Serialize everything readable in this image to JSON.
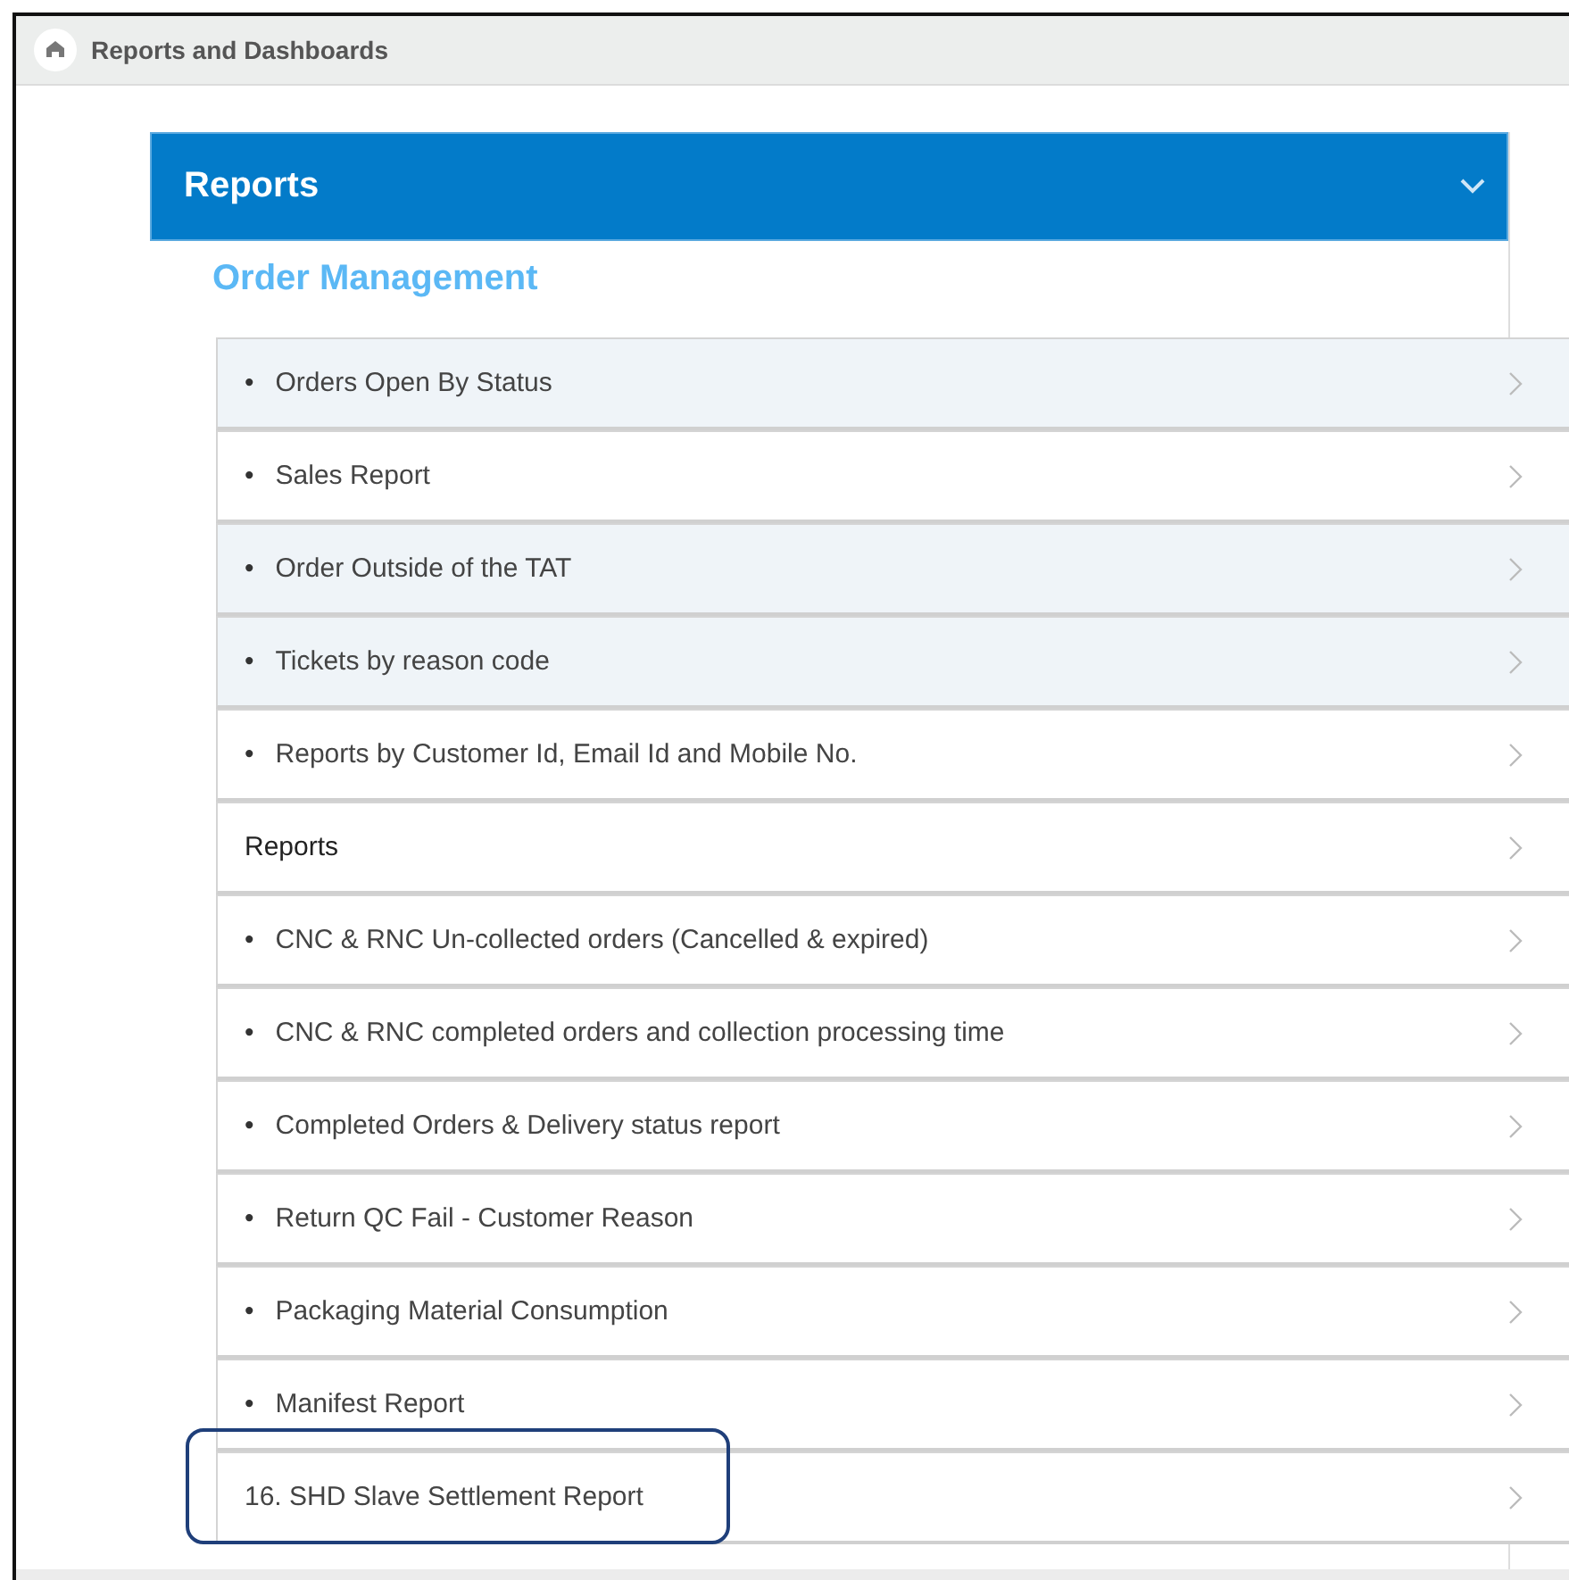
{
  "breadcrumb": {
    "title": "Reports and Dashboards"
  },
  "panel": {
    "title": "Reports",
    "expanded": true,
    "section_title": "Order Management",
    "items": [
      {
        "kind": "bullet",
        "bullet": "•",
        "label": "Orders Open By Status",
        "shaded": true,
        "annotated": false
      },
      {
        "kind": "bullet",
        "bullet": "•",
        "label": "Sales Report",
        "shaded": false,
        "annotated": false
      },
      {
        "kind": "bullet",
        "bullet": "•",
        "label": "Order Outside of the TAT",
        "shaded": true,
        "annotated": false
      },
      {
        "kind": "bullet",
        "bullet": "•",
        "label": "Tickets by reason code",
        "shaded": true,
        "annotated": false
      },
      {
        "kind": "bullet",
        "bullet": "•",
        "label": "Reports by Customer Id, Email Id and Mobile No.",
        "shaded": false,
        "annotated": false
      },
      {
        "kind": "heading",
        "label": "Reports",
        "shaded": false,
        "annotated": false
      },
      {
        "kind": "bullet",
        "bullet": "•",
        "label": "CNC & RNC Un-collected orders (Cancelled & expired)",
        "shaded": false,
        "annotated": false
      },
      {
        "kind": "bullet",
        "bullet": "•",
        "label": "CNC & RNC completed orders and collection processing time",
        "shaded": false,
        "annotated": false
      },
      {
        "kind": "bullet",
        "bullet": "•",
        "label": "Completed Orders & Delivery status report",
        "shaded": false,
        "annotated": false
      },
      {
        "kind": "bullet",
        "bullet": "•",
        "label": "Return QC Fail - Customer Reason",
        "shaded": false,
        "annotated": false
      },
      {
        "kind": "bullet",
        "bullet": "•",
        "label": "Packaging Material Consumption",
        "shaded": false,
        "annotated": false
      },
      {
        "kind": "bullet",
        "bullet": "•",
        "label": "Manifest Report",
        "shaded": false,
        "annotated": false
      },
      {
        "kind": "plain",
        "label": "16. SHD Slave Settlement Report",
        "shaded": false,
        "annotated": true
      }
    ]
  }
}
